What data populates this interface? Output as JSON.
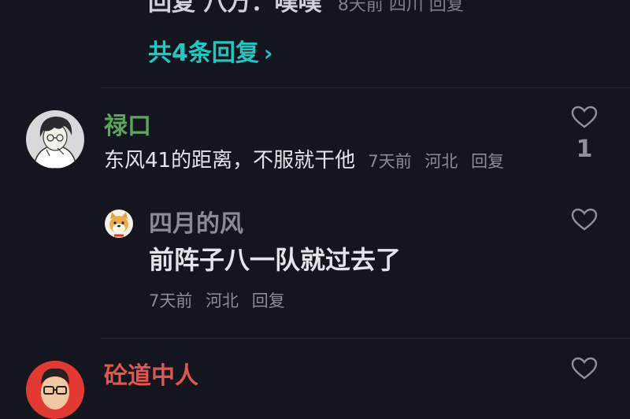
{
  "previous_thread": {
    "partial_reply_text": "回复 八万：噗噗",
    "partial_reply_meta": "8天前 四川 回复",
    "more_replies_label": "共4条回复",
    "more_replies_chevron": "›"
  },
  "comments": [
    {
      "username": "禄口",
      "username_color": "#5aa65a",
      "text": "东风41的距离，不服就干他",
      "time": "7天前",
      "location": "河北",
      "reply_label": "回复",
      "like_count": "1",
      "avatar_icon": "anime-boy-avatar-icon"
    },
    {
      "username": "四月的风",
      "username_color": "#8a8b97",
      "text": "前阵子八一队就过去了",
      "time": "7天前",
      "location": "河北",
      "reply_label": "回复",
      "avatar_icon": "shiba-dog-avatar-icon"
    },
    {
      "username": "砼道中人",
      "username_color": "#e0574e",
      "avatar_icon": "man-with-glasses-avatar-icon"
    }
  ],
  "colors": {
    "background": "#15151f",
    "accent_teal": "#22c7c2",
    "meta_gray": "#8a8b97"
  }
}
